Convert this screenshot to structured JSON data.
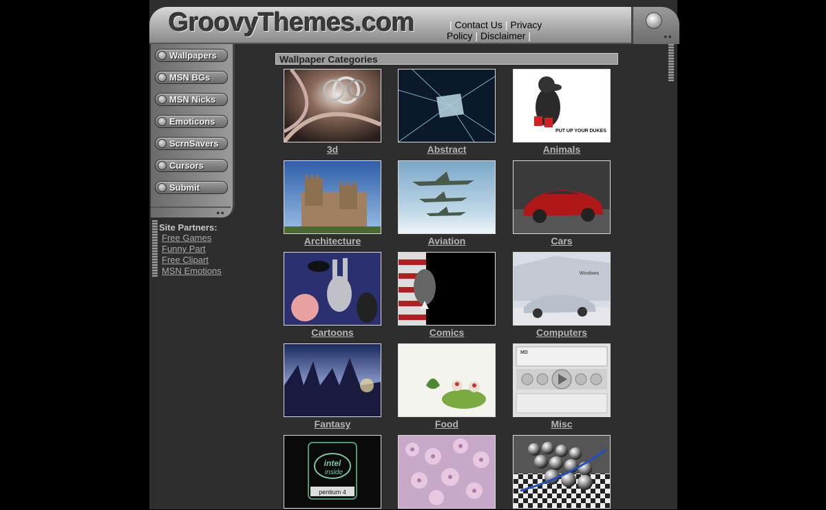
{
  "header": {
    "logo_text": "GroovyThemes.com",
    "links": [
      "Contact Us",
      "Privacy Policy",
      "Disclaimer"
    ]
  },
  "nav": {
    "items": [
      "Wallpapers",
      "MSN BGs",
      "MSN Nicks",
      "Emoticons",
      "ScrnSavers",
      "Cursors",
      "Submit"
    ]
  },
  "partners": {
    "title": "Site Partners:",
    "links": [
      "Free Games",
      "Funny Part",
      "Free Clipart",
      "MSN Emotions"
    ]
  },
  "categories": {
    "title": "Wallpaper Categories",
    "items": [
      "3d",
      "Abstract",
      "Animals",
      "Architecture",
      "Aviation",
      "Cars",
      "Cartoons",
      "Comics",
      "Computers",
      "Fantasy",
      "Food",
      "Misc",
      "",
      "",
      ""
    ]
  },
  "thumb_text": {
    "animals": "PUT UP YOUR DUKES",
    "computers": "Windows",
    "misc_label": "MD",
    "intel1": "intel",
    "intel2": "inside",
    "intel3": "pentium 4"
  },
  "colors": {
    "page_bg": "#2e2e2e",
    "header_grey": "#a8a8a8",
    "link_grey": "#b5b5b5",
    "category_bar": "#9b9b9b"
  }
}
